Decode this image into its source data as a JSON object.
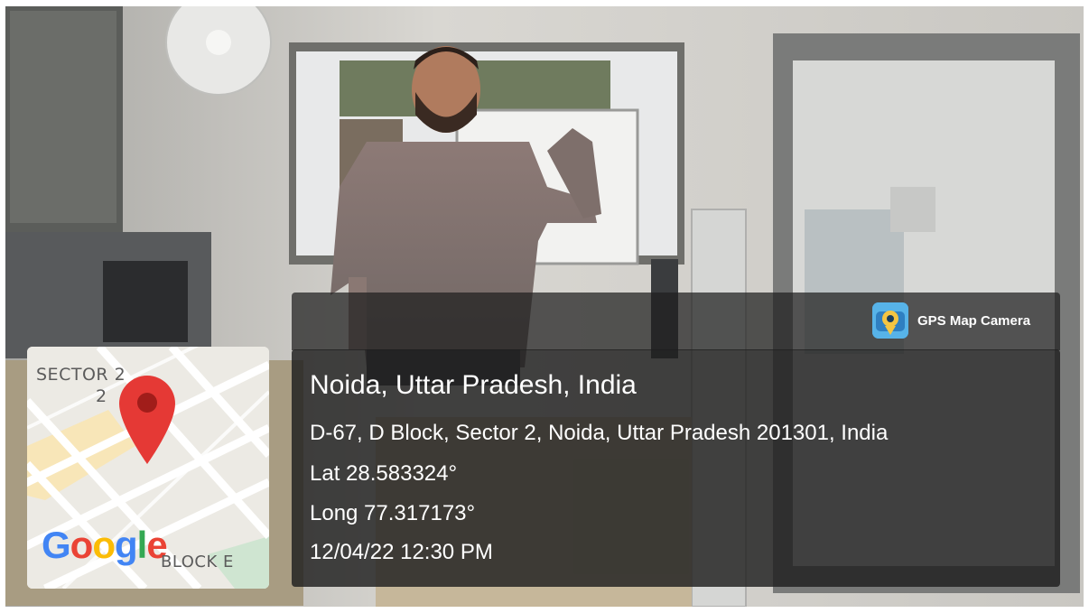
{
  "app": {
    "name": "GPS Map Camera",
    "icon": "gps-camera-app-icon"
  },
  "location": {
    "place": "Noida, Uttar Pradesh, India",
    "address": "D-67, D Block, Sector 2, Noida, Uttar Pradesh 201301, India",
    "latitude": "Lat 28.583324°",
    "longitude": "Long 77.317173°",
    "datetime": "12/04/22 12:30 PM"
  },
  "map": {
    "labels": {
      "sector_line1": "SECTOR 2",
      "sector_line2": "2",
      "block": "BLOCK E"
    },
    "provider": [
      "G",
      "o",
      "o",
      "g",
      "l",
      "e"
    ],
    "pin_color": "#e53935",
    "marker_icon": "map-pin-icon"
  },
  "colors": {
    "overlay": "#1e1e1e",
    "text": "#ffffff"
  }
}
